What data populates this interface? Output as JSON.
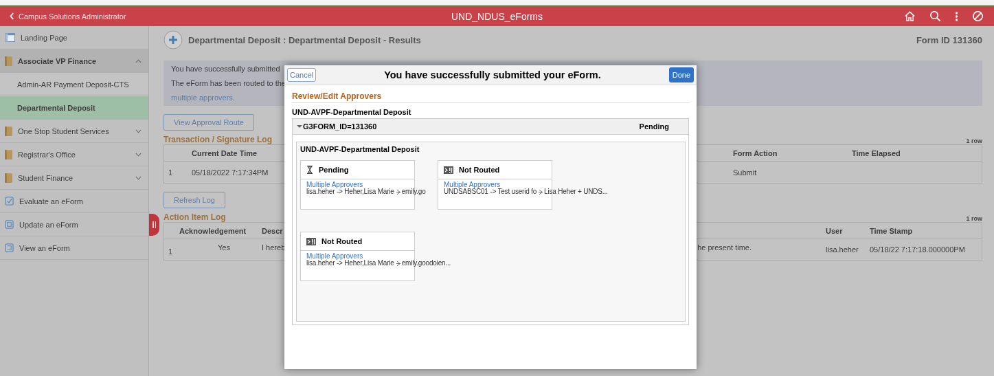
{
  "header": {
    "back_label": "Campus Solutions Administrator",
    "title": "UND_NDUS_eForms"
  },
  "sidebar": {
    "items": [
      {
        "label": "Landing Page",
        "kind": "page",
        "selected": false
      },
      {
        "label": "Associate VP Finance",
        "kind": "folder",
        "expanded": true,
        "selected": false,
        "children": [
          {
            "label": "Admin-AR Payment Deposit-CTS",
            "selected": false
          },
          {
            "label": "Departmental Deposit",
            "selected": true
          }
        ]
      },
      {
        "label": "One Stop Student Services",
        "kind": "folder",
        "expanded": false,
        "selected": false
      },
      {
        "label": "Registrar's Office",
        "kind": "folder",
        "expanded": false,
        "selected": false
      },
      {
        "label": "Student Finance",
        "kind": "folder",
        "expanded": false,
        "selected": false
      },
      {
        "label": "Evaluate an eForm",
        "kind": "evaluate",
        "selected": false
      },
      {
        "label": "Update an eForm",
        "kind": "update",
        "selected": false
      },
      {
        "label": "View an eForm",
        "kind": "view",
        "selected": false
      }
    ]
  },
  "page": {
    "title": "Departmental Deposit : Departmental Deposit - Results",
    "form_id": "Form ID 131360",
    "messages": [
      "You have successfully submitted",
      "The eForm has been routed to the"
    ],
    "message_link": "multiple approvers.",
    "view_route_button": "View Approval Route",
    "transaction_log": {
      "title": "Transaction / Signature Log",
      "row_count": "1 row",
      "columns": [
        "Current Date Time",
        "Form Action",
        "Time Elapsed"
      ],
      "rows": [
        {
          "num": "1",
          "date_time": "05/18/2022 7:17:34PM",
          "form_action": "Submit"
        }
      ]
    },
    "refresh_button": "Refresh Log",
    "action_log": {
      "title": "Action Item Log",
      "row_count": "1 row",
      "columns": [
        "Acknowledgement",
        "Descr",
        "User",
        "Time Stamp"
      ],
      "rows": [
        {
          "num": "1",
          "acknowledgement": "Yes",
          "description_start": "I hereb",
          "description_end": "he present time.",
          "user": "lisa.heher",
          "time_stamp": "05/18/22 7:17:18.000000PM"
        }
      ]
    }
  },
  "modal": {
    "cancel": "Cancel",
    "title": "You have successfully submitted your eForm.",
    "done": "Done",
    "section_title": "Review/Edit Approvers",
    "process_name": "UND-AVPF-Departmental Deposit",
    "panel": {
      "label": "G3FORM_ID=131360",
      "status": "Pending",
      "expanded": true,
      "stage": "UND-AVPF-Departmental Deposit",
      "steps": [
        {
          "kind": "pending",
          "status": "Pending",
          "link": "Multiple Approvers",
          "text": "lisa.heher -> Heher,Lisa Marie",
          "more": "emily.go"
        },
        {
          "kind": "not_routed",
          "status": "Not Routed",
          "link": "Multiple Approvers",
          "text": "UNDSABSC01 -> Test userid fo",
          "more": "Lisa Heher + UNDS..."
        },
        {
          "kind": "not_routed",
          "status": "Not Routed",
          "link": "Multiple Approvers",
          "text": "lisa.heher -> Heher,Lisa Marie",
          "more": "emily.goodoien..."
        }
      ]
    }
  }
}
